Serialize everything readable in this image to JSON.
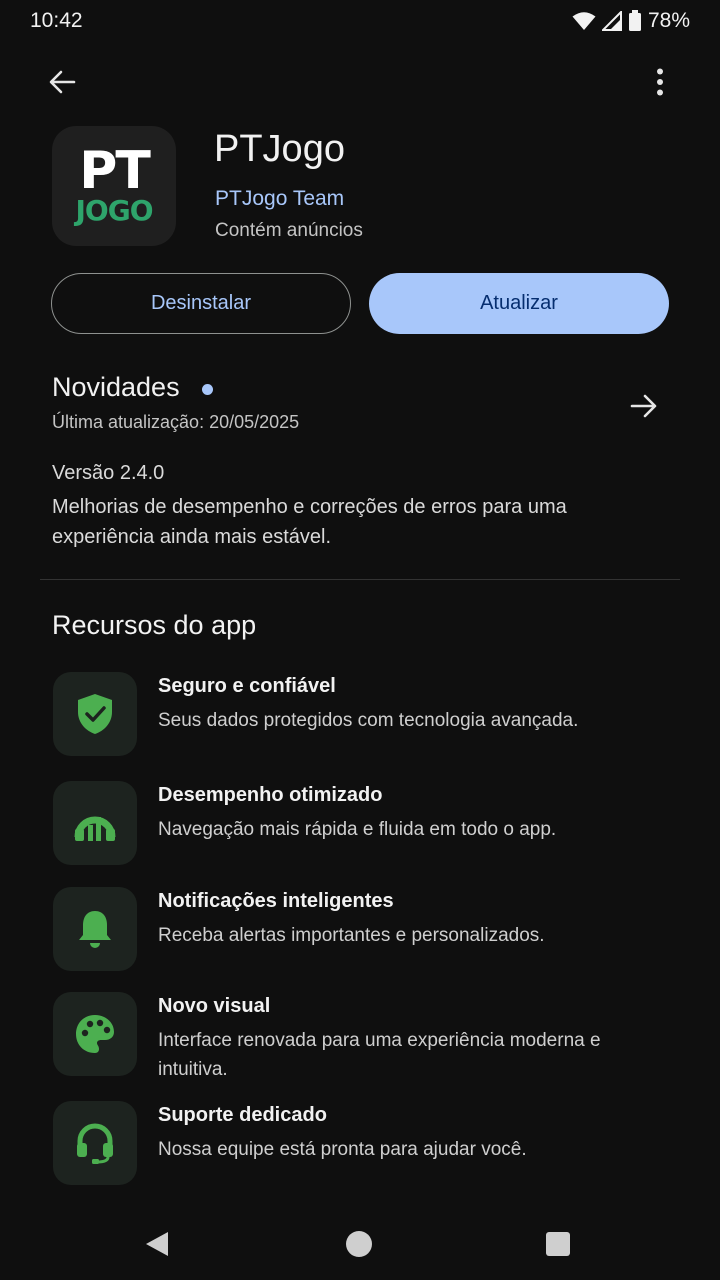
{
  "status_bar": {
    "time": "10:42",
    "battery": "78%"
  },
  "app": {
    "icon_text_top": "PT",
    "icon_text_bottom": "JOGO",
    "name": "PTJogo",
    "developer": "PTJogo Team",
    "ads_notice": "Contém anúncios"
  },
  "buttons": {
    "uninstall": "Desinstalar",
    "update": "Atualizar"
  },
  "news": {
    "title": "Novidades",
    "last_update": "Última atualização: 20/05/2025",
    "version": "Versão 2.4.0",
    "body": "Melhorias de desempenho e correções de erros para uma experiência ainda mais estável."
  },
  "features": {
    "title": "Recursos do app",
    "items": [
      {
        "icon": "shield-check-icon",
        "title": "Seguro e confiável",
        "desc": "Seus dados protegidos com tecnologia avançada."
      },
      {
        "icon": "speedometer-icon",
        "title": "Desempenho otimizado",
        "desc": "Navegação mais rápida e fluida em todo o app."
      },
      {
        "icon": "bell-icon",
        "title": "Notificações inteligentes",
        "desc": "Receba alertas importantes e personalizados."
      },
      {
        "icon": "palette-icon",
        "title": "Novo visual",
        "desc": "Interface renovada para uma experiência moderna e intuitiva."
      },
      {
        "icon": "headset-icon",
        "title": "Suporte dedicado",
        "desc": "Nossa equipe está pronta para ajudar você."
      }
    ]
  },
  "colors": {
    "accent": "#a8c7fa",
    "feature_green": "#4caf50",
    "background": "#0f0f0f"
  }
}
